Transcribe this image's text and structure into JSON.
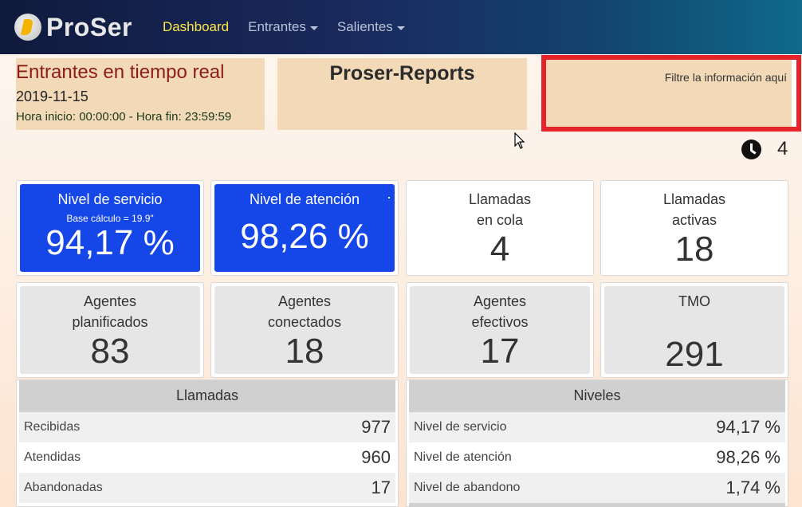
{
  "nav": {
    "brand": "ProSer",
    "links": [
      {
        "label": "Dashboard",
        "active": true,
        "dropdown": false
      },
      {
        "label": "Entrantes",
        "active": false,
        "dropdown": true
      },
      {
        "label": "Salientes",
        "active": false,
        "dropdown": true
      }
    ]
  },
  "header": {
    "realtime_title": "Entrantes en tiempo real",
    "date": "2019-11-15",
    "hours": "Hora inicio: 00:00:00 - Hora fin: 23:59:59",
    "app_title": "Proser-Reports",
    "filter_hint": "Filtre la información aquí",
    "refresh_count": "4"
  },
  "cards_row1": [
    {
      "label": "Nivel de servicio",
      "sub": "Base cálculo = 19.9\"",
      "value": "94,17 %",
      "style": "blue"
    },
    {
      "label": "Nivel de atención",
      "value": "98,26 %",
      "style": "blue"
    },
    {
      "label": "Llamadas",
      "label2": "en cola",
      "value": "4",
      "style": "white"
    },
    {
      "label": "Llamadas",
      "label2": "activas",
      "value": "18",
      "style": "white"
    }
  ],
  "cards_row2": [
    {
      "label": "Agentes",
      "label2": "planificados",
      "value": "83",
      "style": "grey"
    },
    {
      "label": "Agentes",
      "label2": "conectados",
      "value": "18",
      "style": "grey"
    },
    {
      "label": "Agentes",
      "label2": "efectivos",
      "value": "17",
      "style": "grey"
    },
    {
      "label": "TMO",
      "value": "291",
      "style": "grey"
    }
  ],
  "llamadas": {
    "title": "Llamadas",
    "rows": [
      {
        "k": "Recibidas",
        "v": "977"
      },
      {
        "k": "Atendidas",
        "v": "960"
      },
      {
        "k": "Abandonadas",
        "v": "17"
      }
    ]
  },
  "niveles": {
    "title": "Niveles",
    "rows": [
      {
        "k": "Nivel de servicio",
        "v": "94,17 %"
      },
      {
        "k": "Nivel de atención",
        "v": "98,26 %"
      },
      {
        "k": "Nivel de abandono",
        "v": "1,74 %"
      }
    ]
  },
  "colors": {
    "accent_blue": "#1546e8",
    "active_nav": "#ffe94a",
    "header_box": "#f2d9b8",
    "filter_border": "#e4232a",
    "title_red": "#8e1b1b"
  }
}
